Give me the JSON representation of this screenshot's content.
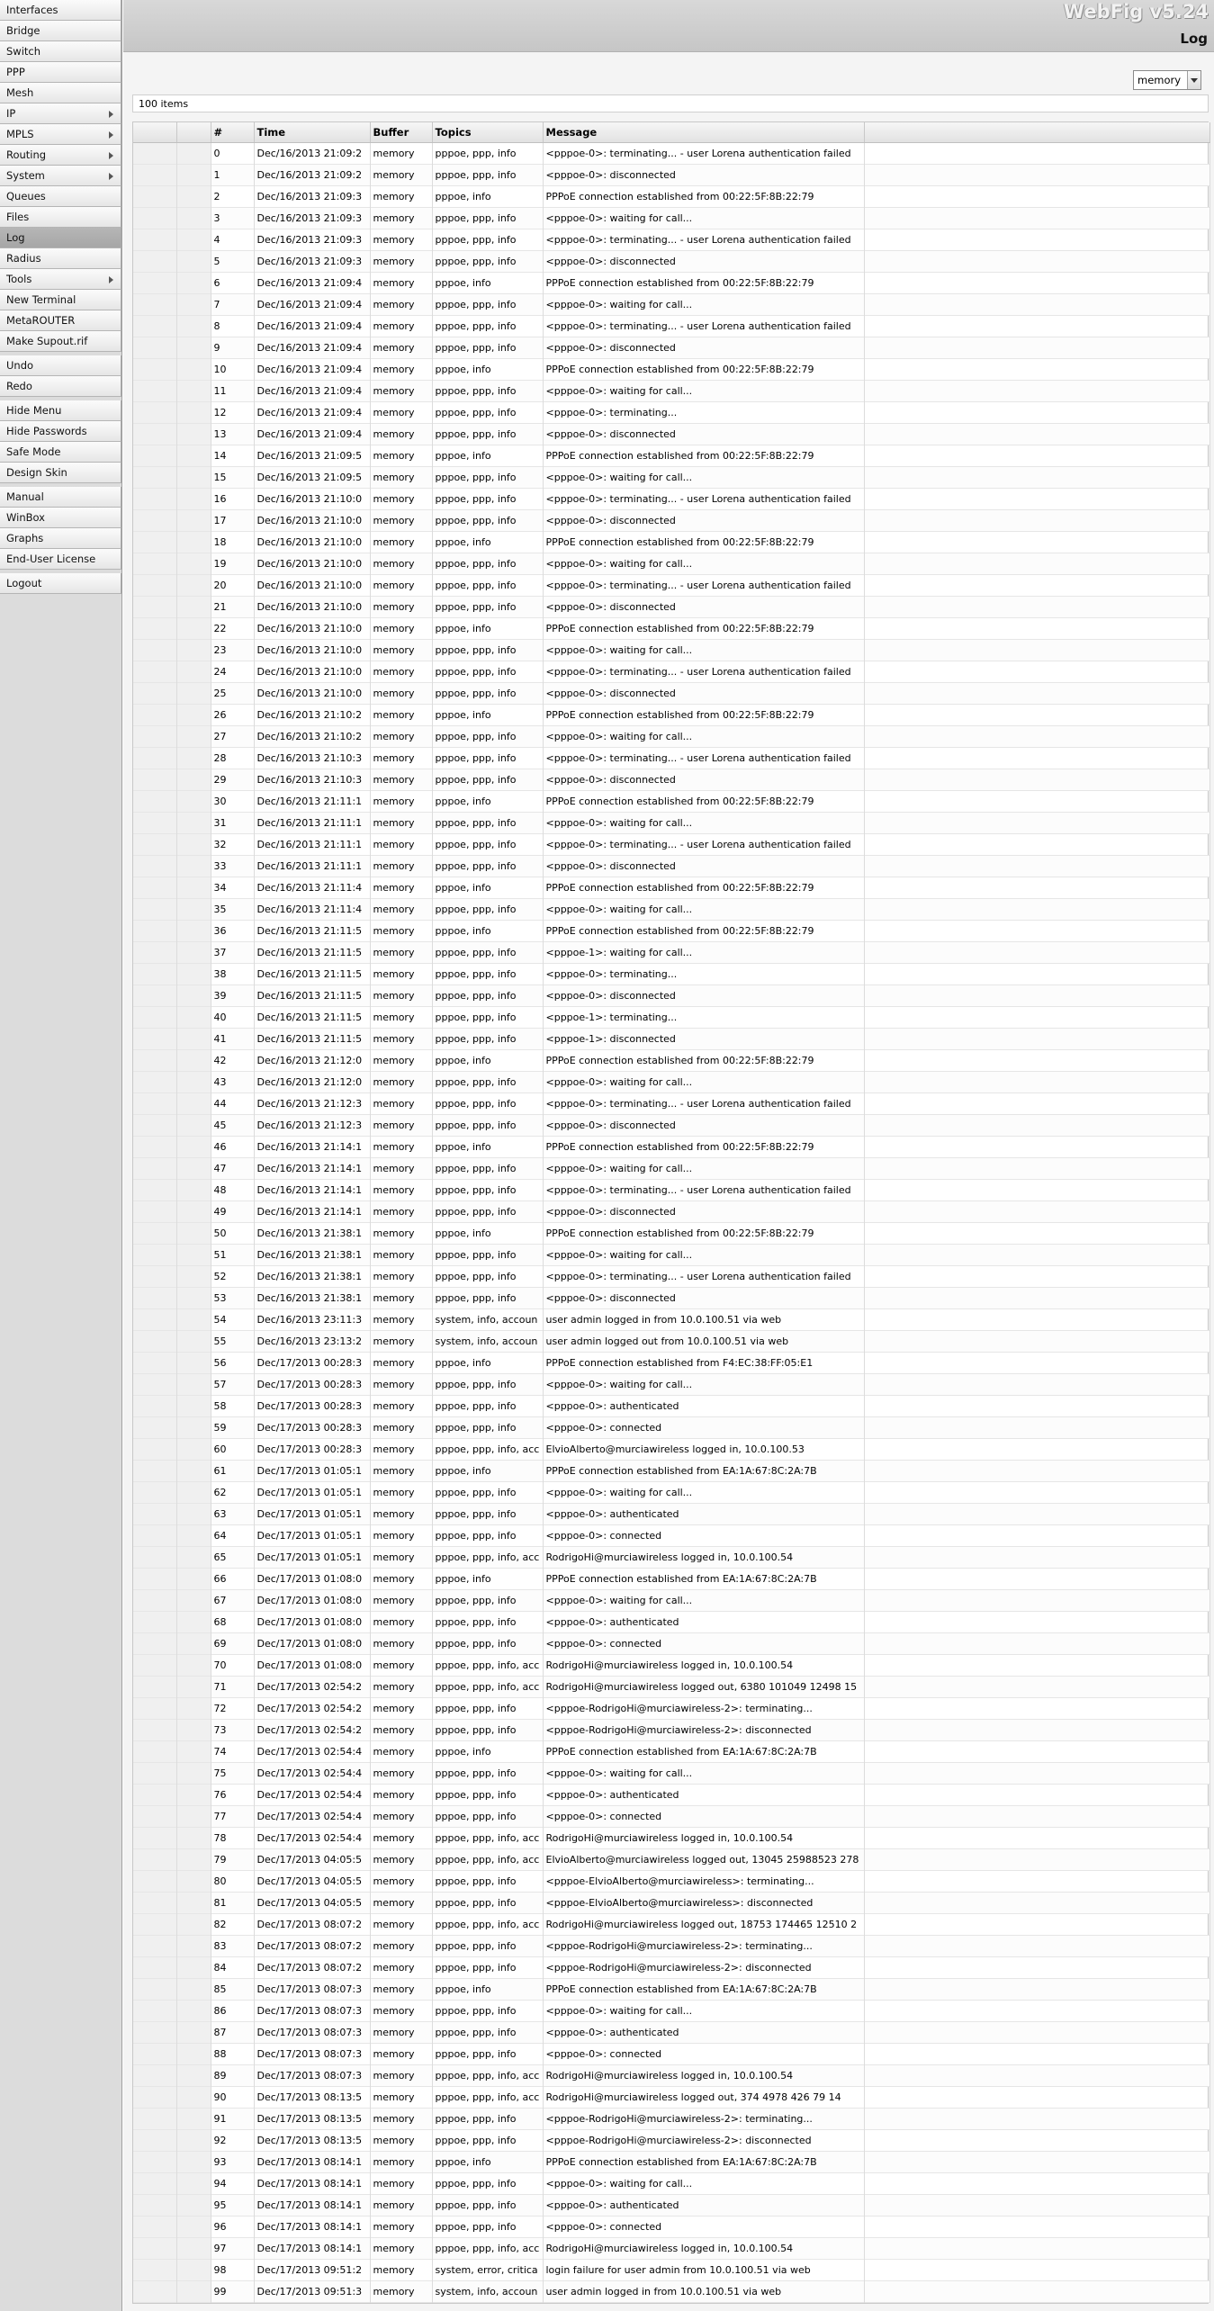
{
  "brand": "WebFig v5.24",
  "page_title": "Log",
  "buffer_select": {
    "value": "memory"
  },
  "items_count": "100 items",
  "menu": [
    [
      {
        "id": "interfaces",
        "label": "Interfaces",
        "arrow": false
      },
      {
        "id": "bridge",
        "label": "Bridge",
        "arrow": false
      },
      {
        "id": "switch",
        "label": "Switch",
        "arrow": false
      },
      {
        "id": "ppp",
        "label": "PPP",
        "arrow": false
      },
      {
        "id": "mesh",
        "label": "Mesh",
        "arrow": false
      },
      {
        "id": "ip",
        "label": "IP",
        "arrow": true
      },
      {
        "id": "mpls",
        "label": "MPLS",
        "arrow": true
      },
      {
        "id": "routing",
        "label": "Routing",
        "arrow": true
      },
      {
        "id": "system",
        "label": "System",
        "arrow": true
      },
      {
        "id": "queues",
        "label": "Queues",
        "arrow": false
      },
      {
        "id": "files",
        "label": "Files",
        "arrow": false
      },
      {
        "id": "log",
        "label": "Log",
        "arrow": false,
        "active": true
      },
      {
        "id": "radius",
        "label": "Radius",
        "arrow": false
      },
      {
        "id": "tools",
        "label": "Tools",
        "arrow": true
      },
      {
        "id": "new-terminal",
        "label": "New Terminal",
        "arrow": false
      },
      {
        "id": "metarouter",
        "label": "MetaROUTER",
        "arrow": false
      },
      {
        "id": "make-supout",
        "label": "Make Supout.rif",
        "arrow": false
      }
    ],
    [
      {
        "id": "undo",
        "label": "Undo",
        "arrow": false
      },
      {
        "id": "redo",
        "label": "Redo",
        "arrow": false
      }
    ],
    [
      {
        "id": "hide-menu",
        "label": "Hide Menu",
        "arrow": false
      },
      {
        "id": "hide-passwords",
        "label": "Hide Passwords",
        "arrow": false
      },
      {
        "id": "safe-mode",
        "label": "Safe Mode",
        "arrow": false
      },
      {
        "id": "design-skin",
        "label": "Design Skin",
        "arrow": false
      }
    ],
    [
      {
        "id": "manual",
        "label": "Manual",
        "arrow": false
      },
      {
        "id": "winbox",
        "label": "WinBox",
        "arrow": false
      },
      {
        "id": "graphs",
        "label": "Graphs",
        "arrow": false
      },
      {
        "id": "end-user-license",
        "label": "End-User License",
        "arrow": false
      }
    ],
    [
      {
        "id": "logout",
        "label": "Logout",
        "arrow": false
      }
    ]
  ],
  "table": {
    "columns": [
      "",
      "",
      "#",
      "Time",
      "Buffer",
      "Topics",
      "Message"
    ],
    "rows": [
      [
        "0",
        "Dec/16/2013 21:09:2",
        "memory",
        "pppoe, ppp, info",
        "<pppoe-0>: terminating... - user Lorena authentication failed"
      ],
      [
        "1",
        "Dec/16/2013 21:09:2",
        "memory",
        "pppoe, ppp, info",
        "<pppoe-0>: disconnected"
      ],
      [
        "2",
        "Dec/16/2013 21:09:3",
        "memory",
        "pppoe, info",
        "PPPoE connection established from 00:22:5F:8B:22:79"
      ],
      [
        "3",
        "Dec/16/2013 21:09:3",
        "memory",
        "pppoe, ppp, info",
        "<pppoe-0>: waiting for call..."
      ],
      [
        "4",
        "Dec/16/2013 21:09:3",
        "memory",
        "pppoe, ppp, info",
        "<pppoe-0>: terminating... - user Lorena authentication failed"
      ],
      [
        "5",
        "Dec/16/2013 21:09:3",
        "memory",
        "pppoe, ppp, info",
        "<pppoe-0>: disconnected"
      ],
      [
        "6",
        "Dec/16/2013 21:09:4",
        "memory",
        "pppoe, info",
        "PPPoE connection established from 00:22:5F:8B:22:79"
      ],
      [
        "7",
        "Dec/16/2013 21:09:4",
        "memory",
        "pppoe, ppp, info",
        "<pppoe-0>: waiting for call..."
      ],
      [
        "8",
        "Dec/16/2013 21:09:4",
        "memory",
        "pppoe, ppp, info",
        "<pppoe-0>: terminating... - user Lorena authentication failed"
      ],
      [
        "9",
        "Dec/16/2013 21:09:4",
        "memory",
        "pppoe, ppp, info",
        "<pppoe-0>: disconnected"
      ],
      [
        "10",
        "Dec/16/2013 21:09:4",
        "memory",
        "pppoe, info",
        "PPPoE connection established from 00:22:5F:8B:22:79"
      ],
      [
        "11",
        "Dec/16/2013 21:09:4",
        "memory",
        "pppoe, ppp, info",
        "<pppoe-0>: waiting for call..."
      ],
      [
        "12",
        "Dec/16/2013 21:09:4",
        "memory",
        "pppoe, ppp, info",
        "<pppoe-0>: terminating..."
      ],
      [
        "13",
        "Dec/16/2013 21:09:4",
        "memory",
        "pppoe, ppp, info",
        "<pppoe-0>: disconnected"
      ],
      [
        "14",
        "Dec/16/2013 21:09:5",
        "memory",
        "pppoe, info",
        "PPPoE connection established from 00:22:5F:8B:22:79"
      ],
      [
        "15",
        "Dec/16/2013 21:09:5",
        "memory",
        "pppoe, ppp, info",
        "<pppoe-0>: waiting for call..."
      ],
      [
        "16",
        "Dec/16/2013 21:10:0",
        "memory",
        "pppoe, ppp, info",
        "<pppoe-0>: terminating... - user Lorena authentication failed"
      ],
      [
        "17",
        "Dec/16/2013 21:10:0",
        "memory",
        "pppoe, ppp, info",
        "<pppoe-0>: disconnected"
      ],
      [
        "18",
        "Dec/16/2013 21:10:0",
        "memory",
        "pppoe, info",
        "PPPoE connection established from 00:22:5F:8B:22:79"
      ],
      [
        "19",
        "Dec/16/2013 21:10:0",
        "memory",
        "pppoe, ppp, info",
        "<pppoe-0>: waiting for call..."
      ],
      [
        "20",
        "Dec/16/2013 21:10:0",
        "memory",
        "pppoe, ppp, info",
        "<pppoe-0>: terminating... - user Lorena authentication failed"
      ],
      [
        "21",
        "Dec/16/2013 21:10:0",
        "memory",
        "pppoe, ppp, info",
        "<pppoe-0>: disconnected"
      ],
      [
        "22",
        "Dec/16/2013 21:10:0",
        "memory",
        "pppoe, info",
        "PPPoE connection established from 00:22:5F:8B:22:79"
      ],
      [
        "23",
        "Dec/16/2013 21:10:0",
        "memory",
        "pppoe, ppp, info",
        "<pppoe-0>: waiting for call..."
      ],
      [
        "24",
        "Dec/16/2013 21:10:0",
        "memory",
        "pppoe, ppp, info",
        "<pppoe-0>: terminating... - user Lorena authentication failed"
      ],
      [
        "25",
        "Dec/16/2013 21:10:0",
        "memory",
        "pppoe, ppp, info",
        "<pppoe-0>: disconnected"
      ],
      [
        "26",
        "Dec/16/2013 21:10:2",
        "memory",
        "pppoe, info",
        "PPPoE connection established from 00:22:5F:8B:22:79"
      ],
      [
        "27",
        "Dec/16/2013 21:10:2",
        "memory",
        "pppoe, ppp, info",
        "<pppoe-0>: waiting for call..."
      ],
      [
        "28",
        "Dec/16/2013 21:10:3",
        "memory",
        "pppoe, ppp, info",
        "<pppoe-0>: terminating... - user Lorena authentication failed"
      ],
      [
        "29",
        "Dec/16/2013 21:10:3",
        "memory",
        "pppoe, ppp, info",
        "<pppoe-0>: disconnected"
      ],
      [
        "30",
        "Dec/16/2013 21:11:1",
        "memory",
        "pppoe, info",
        "PPPoE connection established from 00:22:5F:8B:22:79"
      ],
      [
        "31",
        "Dec/16/2013 21:11:1",
        "memory",
        "pppoe, ppp, info",
        "<pppoe-0>: waiting for call..."
      ],
      [
        "32",
        "Dec/16/2013 21:11:1",
        "memory",
        "pppoe, ppp, info",
        "<pppoe-0>: terminating... - user Lorena authentication failed"
      ],
      [
        "33",
        "Dec/16/2013 21:11:1",
        "memory",
        "pppoe, ppp, info",
        "<pppoe-0>: disconnected"
      ],
      [
        "34",
        "Dec/16/2013 21:11:4",
        "memory",
        "pppoe, info",
        "PPPoE connection established from 00:22:5F:8B:22:79"
      ],
      [
        "35",
        "Dec/16/2013 21:11:4",
        "memory",
        "pppoe, ppp, info",
        "<pppoe-0>: waiting for call..."
      ],
      [
        "36",
        "Dec/16/2013 21:11:5",
        "memory",
        "pppoe, info",
        "PPPoE connection established from 00:22:5F:8B:22:79"
      ],
      [
        "37",
        "Dec/16/2013 21:11:5",
        "memory",
        "pppoe, ppp, info",
        "<pppoe-1>: waiting for call..."
      ],
      [
        "38",
        "Dec/16/2013 21:11:5",
        "memory",
        "pppoe, ppp, info",
        "<pppoe-0>: terminating..."
      ],
      [
        "39",
        "Dec/16/2013 21:11:5",
        "memory",
        "pppoe, ppp, info",
        "<pppoe-0>: disconnected"
      ],
      [
        "40",
        "Dec/16/2013 21:11:5",
        "memory",
        "pppoe, ppp, info",
        "<pppoe-1>: terminating..."
      ],
      [
        "41",
        "Dec/16/2013 21:11:5",
        "memory",
        "pppoe, ppp, info",
        "<pppoe-1>: disconnected"
      ],
      [
        "42",
        "Dec/16/2013 21:12:0",
        "memory",
        "pppoe, info",
        "PPPoE connection established from 00:22:5F:8B:22:79"
      ],
      [
        "43",
        "Dec/16/2013 21:12:0",
        "memory",
        "pppoe, ppp, info",
        "<pppoe-0>: waiting for call..."
      ],
      [
        "44",
        "Dec/16/2013 21:12:3",
        "memory",
        "pppoe, ppp, info",
        "<pppoe-0>: terminating... - user Lorena authentication failed"
      ],
      [
        "45",
        "Dec/16/2013 21:12:3",
        "memory",
        "pppoe, ppp, info",
        "<pppoe-0>: disconnected"
      ],
      [
        "46",
        "Dec/16/2013 21:14:1",
        "memory",
        "pppoe, info",
        "PPPoE connection established from 00:22:5F:8B:22:79"
      ],
      [
        "47",
        "Dec/16/2013 21:14:1",
        "memory",
        "pppoe, ppp, info",
        "<pppoe-0>: waiting for call..."
      ],
      [
        "48",
        "Dec/16/2013 21:14:1",
        "memory",
        "pppoe, ppp, info",
        "<pppoe-0>: terminating... - user Lorena authentication failed"
      ],
      [
        "49",
        "Dec/16/2013 21:14:1",
        "memory",
        "pppoe, ppp, info",
        "<pppoe-0>: disconnected"
      ],
      [
        "50",
        "Dec/16/2013 21:38:1",
        "memory",
        "pppoe, info",
        "PPPoE connection established from 00:22:5F:8B:22:79"
      ],
      [
        "51",
        "Dec/16/2013 21:38:1",
        "memory",
        "pppoe, ppp, info",
        "<pppoe-0>: waiting for call..."
      ],
      [
        "52",
        "Dec/16/2013 21:38:1",
        "memory",
        "pppoe, ppp, info",
        "<pppoe-0>: terminating... - user Lorena authentication failed"
      ],
      [
        "53",
        "Dec/16/2013 21:38:1",
        "memory",
        "pppoe, ppp, info",
        "<pppoe-0>: disconnected"
      ],
      [
        "54",
        "Dec/16/2013 23:11:3",
        "memory",
        "system, info, accoun",
        "user admin logged in from 10.0.100.51 via web"
      ],
      [
        "55",
        "Dec/16/2013 23:13:2",
        "memory",
        "system, info, accoun",
        "user admin logged out from 10.0.100.51 via web"
      ],
      [
        "56",
        "Dec/17/2013 00:28:3",
        "memory",
        "pppoe, info",
        "PPPoE connection established from F4:EC:38:FF:05:E1"
      ],
      [
        "57",
        "Dec/17/2013 00:28:3",
        "memory",
        "pppoe, ppp, info",
        "<pppoe-0>: waiting for call..."
      ],
      [
        "58",
        "Dec/17/2013 00:28:3",
        "memory",
        "pppoe, ppp, info",
        "<pppoe-0>: authenticated"
      ],
      [
        "59",
        "Dec/17/2013 00:28:3",
        "memory",
        "pppoe, ppp, info",
        "<pppoe-0>: connected"
      ],
      [
        "60",
        "Dec/17/2013 00:28:3",
        "memory",
        "pppoe, ppp, info, acc",
        "ElvioAlberto@murciawireless logged in, 10.0.100.53"
      ],
      [
        "61",
        "Dec/17/2013 01:05:1",
        "memory",
        "pppoe, info",
        "PPPoE connection established from EA:1A:67:8C:2A:7B"
      ],
      [
        "62",
        "Dec/17/2013 01:05:1",
        "memory",
        "pppoe, ppp, info",
        "<pppoe-0>: waiting for call..."
      ],
      [
        "63",
        "Dec/17/2013 01:05:1",
        "memory",
        "pppoe, ppp, info",
        "<pppoe-0>: authenticated"
      ],
      [
        "64",
        "Dec/17/2013 01:05:1",
        "memory",
        "pppoe, ppp, info",
        "<pppoe-0>: connected"
      ],
      [
        "65",
        "Dec/17/2013 01:05:1",
        "memory",
        "pppoe, ppp, info, acc",
        "RodrigoHi@murciawireless logged in, 10.0.100.54"
      ],
      [
        "66",
        "Dec/17/2013 01:08:0",
        "memory",
        "pppoe, info",
        "PPPoE connection established from EA:1A:67:8C:2A:7B"
      ],
      [
        "67",
        "Dec/17/2013 01:08:0",
        "memory",
        "pppoe, ppp, info",
        "<pppoe-0>: waiting for call..."
      ],
      [
        "68",
        "Dec/17/2013 01:08:0",
        "memory",
        "pppoe, ppp, info",
        "<pppoe-0>: authenticated"
      ],
      [
        "69",
        "Dec/17/2013 01:08:0",
        "memory",
        "pppoe, ppp, info",
        "<pppoe-0>: connected"
      ],
      [
        "70",
        "Dec/17/2013 01:08:0",
        "memory",
        "pppoe, ppp, info, acc",
        "RodrigoHi@murciawireless logged in, 10.0.100.54"
      ],
      [
        "71",
        "Dec/17/2013 02:54:2",
        "memory",
        "pppoe, ppp, info, acc",
        "RodrigoHi@murciawireless logged out, 6380 101049 12498 15"
      ],
      [
        "72",
        "Dec/17/2013 02:54:2",
        "memory",
        "pppoe, ppp, info",
        "<pppoe-RodrigoHi@murciawireless-2>: terminating..."
      ],
      [
        "73",
        "Dec/17/2013 02:54:2",
        "memory",
        "pppoe, ppp, info",
        "<pppoe-RodrigoHi@murciawireless-2>: disconnected"
      ],
      [
        "74",
        "Dec/17/2013 02:54:4",
        "memory",
        "pppoe, info",
        "PPPoE connection established from EA:1A:67:8C:2A:7B"
      ],
      [
        "75",
        "Dec/17/2013 02:54:4",
        "memory",
        "pppoe, ppp, info",
        "<pppoe-0>: waiting for call..."
      ],
      [
        "76",
        "Dec/17/2013 02:54:4",
        "memory",
        "pppoe, ppp, info",
        "<pppoe-0>: authenticated"
      ],
      [
        "77",
        "Dec/17/2013 02:54:4",
        "memory",
        "pppoe, ppp, info",
        "<pppoe-0>: connected"
      ],
      [
        "78",
        "Dec/17/2013 02:54:4",
        "memory",
        "pppoe, ppp, info, acc",
        "RodrigoHi@murciawireless logged in, 10.0.100.54"
      ],
      [
        "79",
        "Dec/17/2013 04:05:5",
        "memory",
        "pppoe, ppp, info, acc",
        "ElvioAlberto@murciawireless logged out, 13045 25988523 278"
      ],
      [
        "80",
        "Dec/17/2013 04:05:5",
        "memory",
        "pppoe, ppp, info",
        "<pppoe-ElvioAlberto@murciawireless>: terminating..."
      ],
      [
        "81",
        "Dec/17/2013 04:05:5",
        "memory",
        "pppoe, ppp, info",
        "<pppoe-ElvioAlberto@murciawireless>: disconnected"
      ],
      [
        "82",
        "Dec/17/2013 08:07:2",
        "memory",
        "pppoe, ppp, info, acc",
        "RodrigoHi@murciawireless logged out, 18753 174465 12510 2"
      ],
      [
        "83",
        "Dec/17/2013 08:07:2",
        "memory",
        "pppoe, ppp, info",
        "<pppoe-RodrigoHi@murciawireless-2>: terminating..."
      ],
      [
        "84",
        "Dec/17/2013 08:07:2",
        "memory",
        "pppoe, ppp, info",
        "<pppoe-RodrigoHi@murciawireless-2>: disconnected"
      ],
      [
        "85",
        "Dec/17/2013 08:07:3",
        "memory",
        "pppoe, info",
        "PPPoE connection established from EA:1A:67:8C:2A:7B"
      ],
      [
        "86",
        "Dec/17/2013 08:07:3",
        "memory",
        "pppoe, ppp, info",
        "<pppoe-0>: waiting for call..."
      ],
      [
        "87",
        "Dec/17/2013 08:07:3",
        "memory",
        "pppoe, ppp, info",
        "<pppoe-0>: authenticated"
      ],
      [
        "88",
        "Dec/17/2013 08:07:3",
        "memory",
        "pppoe, ppp, info",
        "<pppoe-0>: connected"
      ],
      [
        "89",
        "Dec/17/2013 08:07:3",
        "memory",
        "pppoe, ppp, info, acc",
        "RodrigoHi@murciawireless logged in, 10.0.100.54"
      ],
      [
        "90",
        "Dec/17/2013 08:13:5",
        "memory",
        "pppoe, ppp, info, acc",
        "RodrigoHi@murciawireless logged out, 374 4978 426 79 14"
      ],
      [
        "91",
        "Dec/17/2013 08:13:5",
        "memory",
        "pppoe, ppp, info",
        "<pppoe-RodrigoHi@murciawireless-2>: terminating..."
      ],
      [
        "92",
        "Dec/17/2013 08:13:5",
        "memory",
        "pppoe, ppp, info",
        "<pppoe-RodrigoHi@murciawireless-2>: disconnected"
      ],
      [
        "93",
        "Dec/17/2013 08:14:1",
        "memory",
        "pppoe, info",
        "PPPoE connection established from EA:1A:67:8C:2A:7B"
      ],
      [
        "94",
        "Dec/17/2013 08:14:1",
        "memory",
        "pppoe, ppp, info",
        "<pppoe-0>: waiting for call..."
      ],
      [
        "95",
        "Dec/17/2013 08:14:1",
        "memory",
        "pppoe, ppp, info",
        "<pppoe-0>: authenticated"
      ],
      [
        "96",
        "Dec/17/2013 08:14:1",
        "memory",
        "pppoe, ppp, info",
        "<pppoe-0>: connected"
      ],
      [
        "97",
        "Dec/17/2013 08:14:1",
        "memory",
        "pppoe, ppp, info, acc",
        "RodrigoHi@murciawireless logged in, 10.0.100.54"
      ],
      [
        "98",
        "Dec/17/2013 09:51:2",
        "memory",
        "system, error, critica",
        "login failure for user admin from 10.0.100.51 via web"
      ],
      [
        "99",
        "Dec/17/2013 09:51:3",
        "memory",
        "system, info, accoun",
        "user admin logged in from 10.0.100.51 via web"
      ]
    ]
  }
}
